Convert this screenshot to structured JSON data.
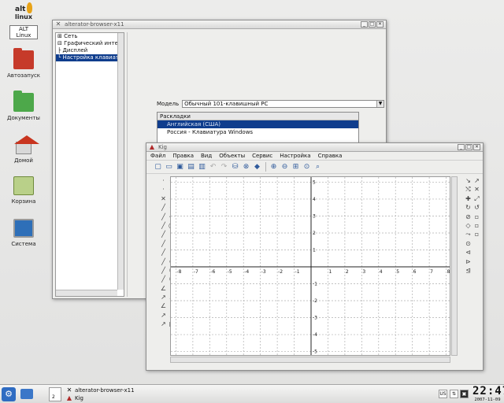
{
  "desktop": {
    "logo": {
      "brand_line1": "alt",
      "brand_line2": "linux",
      "caption": "ALT Linux"
    },
    "icons": [
      {
        "label": "Автозапуск",
        "icon": "folder-red-icon"
      },
      {
        "label": "Документы",
        "icon": "folder-green-icon"
      },
      {
        "label": "Домой",
        "icon": "home-icon"
      },
      {
        "label": "Корзина",
        "icon": "trash-icon"
      },
      {
        "label": "Система",
        "icon": "computer-icon"
      }
    ]
  },
  "alterator": {
    "title": "alterator-browser-x11",
    "tree": [
      {
        "label": "⊞ Сеть",
        "selected": false
      },
      {
        "label": "⊟ Графический интерфейс",
        "selected": false
      },
      {
        "label": "    ├ Дисплей",
        "selected": false
      },
      {
        "label": "    └ Настройка клавиатуры",
        "selected": true
      }
    ],
    "model_label": "Модель",
    "model_value": "Обычный 101-клавишный PC",
    "layouts_header": "Раскладки",
    "layouts": [
      {
        "label": "Английская (США)",
        "selected": true
      },
      {
        "label": "Россия - Клавиатура Windows",
        "selected": false
      }
    ]
  },
  "kig": {
    "title": "Kig",
    "menu": [
      "Файл",
      "Правка",
      "Вид",
      "Объекты",
      "Сервис",
      "Настройка",
      "Справка"
    ],
    "toolbar_icons": [
      "new-icon",
      "open-icon",
      "save-icon",
      "save-as-icon",
      "print-icon",
      "undo-icon",
      "redo-icon",
      "delete-icon",
      "cancel-icon",
      "select-icon",
      "zoom-in-icon",
      "zoom-out-icon",
      "fit-icon",
      "zoom-full-icon",
      "zoom-area-icon"
    ],
    "axes": {
      "x_ticks": [
        "-8",
        "-7",
        "-6",
        "-5",
        "-4",
        "-3",
        "-2",
        "-1",
        "1",
        "2",
        "3",
        "4",
        "5",
        "6",
        "7",
        "8"
      ],
      "y_ticks": [
        "5",
        "4",
        "3",
        "2",
        "1",
        "-1",
        "-2",
        "-3",
        "-4",
        "-5"
      ],
      "xlim": [
        -8.3,
        8.3
      ],
      "ylim": [
        -5.3,
        5.3
      ],
      "grid": true
    }
  },
  "taskbar": {
    "pager_number": "2",
    "tasks": [
      "alterator-browser-x11",
      "Kig"
    ],
    "tray": {
      "lang": "US"
    },
    "clock_time": "22:47",
    "clock_date": "2007-11-09"
  }
}
